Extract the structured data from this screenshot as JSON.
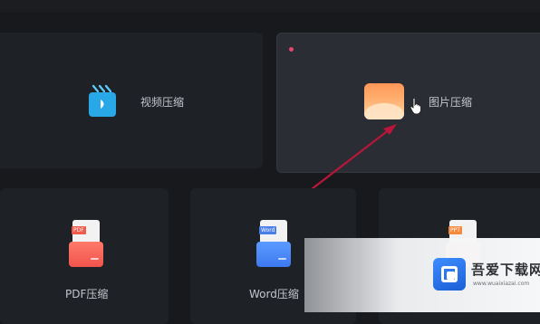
{
  "tools": {
    "video": {
      "label": "视频压缩",
      "icon": "video-clapper-icon"
    },
    "image": {
      "label": "图片压缩",
      "icon": "image-picture-icon",
      "hovered": true
    },
    "pdf": {
      "label": "PDF压缩",
      "icon": "pdf-document-icon",
      "badge": "PDF"
    },
    "word": {
      "label": "Word压缩",
      "icon": "word-document-icon",
      "badge": "Word"
    },
    "ppt": {
      "label": "",
      "icon": "ppt-document-icon",
      "badge": "PPT"
    }
  },
  "annotation": {
    "type": "red-arrow",
    "target": "image-compress-tile",
    "color": "#c41a3c"
  },
  "watermark": {
    "title": "吾爱下载网",
    "url": "www.wuaixiazai.com"
  },
  "colors": {
    "background": "#17191d",
    "tile": "#1e2126",
    "tile_active": "#2a2d33"
  }
}
